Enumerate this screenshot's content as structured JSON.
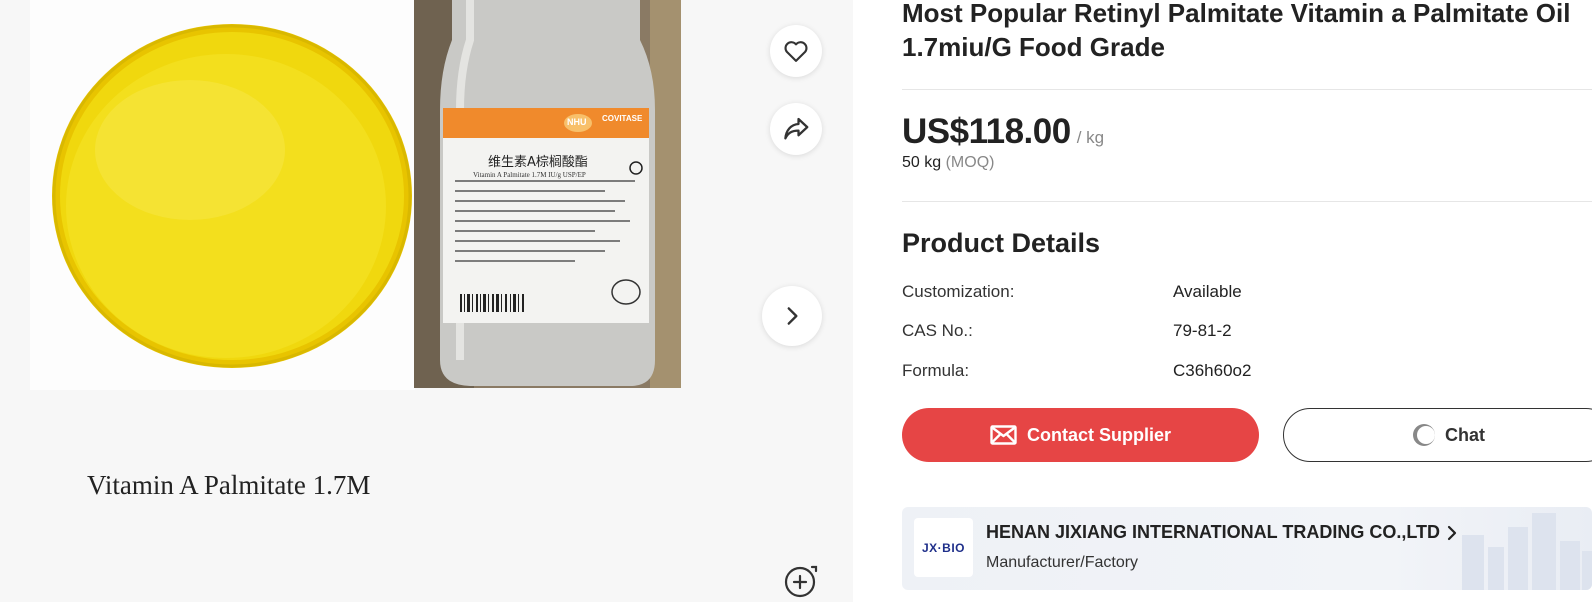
{
  "gallery": {
    "caption": "Vitamin A Palmitate 1.7M",
    "bottle_label_brand": "NHU",
    "bottle_label_product": "COVITASE",
    "bottle_label_cn": "维生素A棕榈酸酯",
    "bottle_label_en": "Vitamin A Palmitate 1.7M IU/g USP/EP",
    "actions": {
      "favorite_icon": "heart-icon",
      "share_icon": "share-icon",
      "next_icon": "chevron-right-icon",
      "zoom_icon": "zoom-in-icon"
    }
  },
  "product": {
    "title": "Most Popular Retinyl Palmitate Vitamin a Palmitate Oil 1.7miu/G Food Grade",
    "price": "US$118.00",
    "unit": "/ kg",
    "moq_value": "50 kg",
    "moq_label": "(MOQ)"
  },
  "details": {
    "title": "Product Details",
    "rows": [
      {
        "key": "Customization:",
        "value": "Available"
      },
      {
        "key": "CAS No.:",
        "value": "79-81-2"
      },
      {
        "key": "Formula:",
        "value": "C36h60o2"
      }
    ]
  },
  "actions": {
    "contact_label": "Contact Supplier",
    "chat_label": "Chat"
  },
  "supplier": {
    "logo_text": "JX·BIO",
    "name": "HENAN JIXIANG INTERNATIONAL TRADING CO.,LTD",
    "type": "Manufacturer/Factory"
  },
  "colors": {
    "accent": "#e64545",
    "oil_yellow": "#f2dc1a",
    "label_orange": "#f08a2c"
  }
}
